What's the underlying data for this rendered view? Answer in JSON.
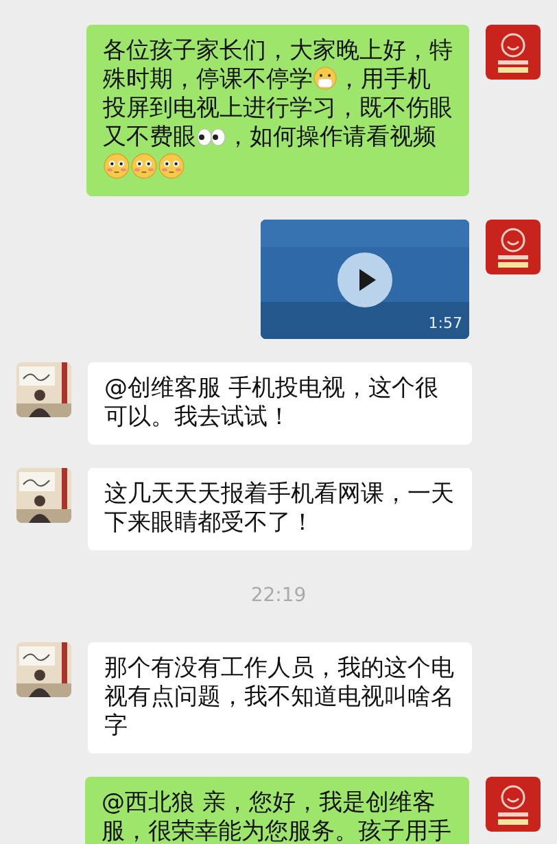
{
  "messages": [
    {
      "kind": "text",
      "outgoing": true,
      "lines": [
        [
          {
            "kind": "text",
            "text": "各位孩子家长们，大家晚上好，特"
          }
        ],
        [
          {
            "kind": "text",
            "text": "殊时期，停课不停学"
          },
          {
            "kind": "mask-emoji"
          },
          {
            "kind": "text",
            "text": "，用手机"
          }
        ],
        [
          {
            "kind": "text",
            "text": "投屏到电视上进行学习，既不伤眼"
          }
        ],
        [
          {
            "kind": "text",
            "text": "又不费眼"
          },
          {
            "kind": "eyes-emoji"
          },
          {
            "kind": "text",
            "text": "，如何操作请看视频"
          }
        ],
        [
          {
            "kind": "face-emoji"
          },
          {
            "kind": "face-emoji"
          },
          {
            "kind": "face-emoji"
          }
        ]
      ]
    },
    {
      "kind": "video",
      "outgoing": true,
      "duration": "1:57"
    },
    {
      "kind": "text",
      "outgoing": false,
      "text": "@创维客服 手机投电视，这个很可以。我去试试！"
    },
    {
      "kind": "text",
      "outgoing": false,
      "text": "这几天天天报着手机看网课，一天下来眼睛都受不了！"
    },
    {
      "kind": "time",
      "text": "22:19"
    },
    {
      "kind": "text",
      "outgoing": false,
      "text": "那个有没有工作人员，我的这个电视有点问题，我不知道电视叫啥名字"
    },
    {
      "kind": "text",
      "outgoing": true,
      "text": "@西北狼 亲，您好，我是创维客服，很荣幸能为您服务。孩子用手"
    }
  ]
}
